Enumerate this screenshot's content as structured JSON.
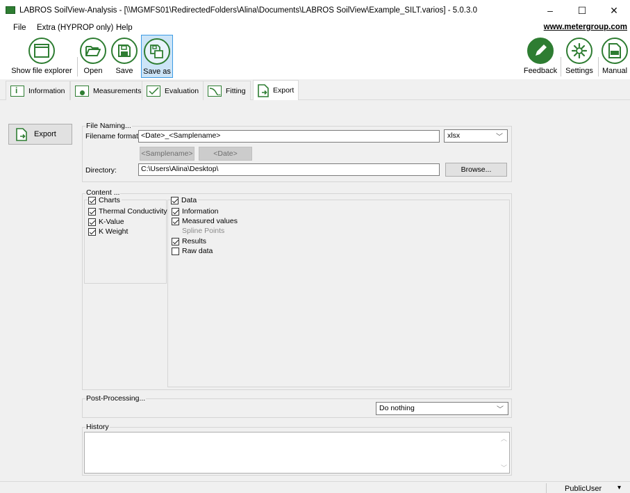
{
  "window": {
    "title": "LABROS SoilView-Analysis - [\\\\MGMFS01\\RedirectedFolders\\Alina\\Documents\\LABROS SoilView\\Example_SILT.varios] - 5.0.3.0",
    "controls": {
      "minimize": "–",
      "maximize": "☐",
      "close": "✕"
    }
  },
  "menu": {
    "items": [
      "File",
      "Extra (HYPROP only)",
      "Help"
    ],
    "link": "www.metergroup.com"
  },
  "ribbon": {
    "show_explorer": "Show file explorer",
    "open": "Open",
    "save": "Save",
    "save_as": "Save as",
    "feedback": "Feedback",
    "settings": "Settings",
    "manual": "Manual"
  },
  "tabs": [
    {
      "label": "Information",
      "icon": "info-icon"
    },
    {
      "label": "Measurements",
      "icon": "measurements-icon"
    },
    {
      "label": "Evaluation",
      "icon": "evaluation-icon"
    },
    {
      "label": "Fitting",
      "icon": "fitting-icon"
    },
    {
      "label": "Export",
      "icon": "export-icon",
      "active": true
    }
  ],
  "export_button": "Export",
  "file_naming": {
    "title": "File Naming...",
    "format_label": "Filename format:",
    "format_value": "<Date>_<Samplename>",
    "ext_value": "xlsx",
    "token_samplename": "<Samplename>",
    "token_date": "<Date>",
    "directory_label": "Directory:",
    "directory_value": "C:\\Users\\Alina\\Desktop\\",
    "browse": "Browse..."
  },
  "content": {
    "title": "Content ...",
    "charts_label": "Charts",
    "charts": [
      {
        "label": "Thermal Conductivity",
        "checked": true
      },
      {
        "label": "K-Value",
        "checked": true
      },
      {
        "label": "K Weight",
        "checked": true
      }
    ],
    "data_label": "Data",
    "data": [
      {
        "label": "Information",
        "checked": true,
        "enabled": true
      },
      {
        "label": "Measured values",
        "checked": true,
        "enabled": true
      },
      {
        "label": "Spline Points",
        "checked": false,
        "enabled": false
      },
      {
        "label": "Results",
        "checked": true,
        "enabled": true
      },
      {
        "label": "Raw data",
        "checked": false,
        "enabled": true
      }
    ]
  },
  "post_processing": {
    "title": "Post-Processing...",
    "value": "Do nothing"
  },
  "history": {
    "title": "History",
    "text": ""
  },
  "status": {
    "user": "PublicUser"
  },
  "colors": {
    "accent_green": "#2e7d32",
    "selected_blue": "#cce4f7"
  }
}
